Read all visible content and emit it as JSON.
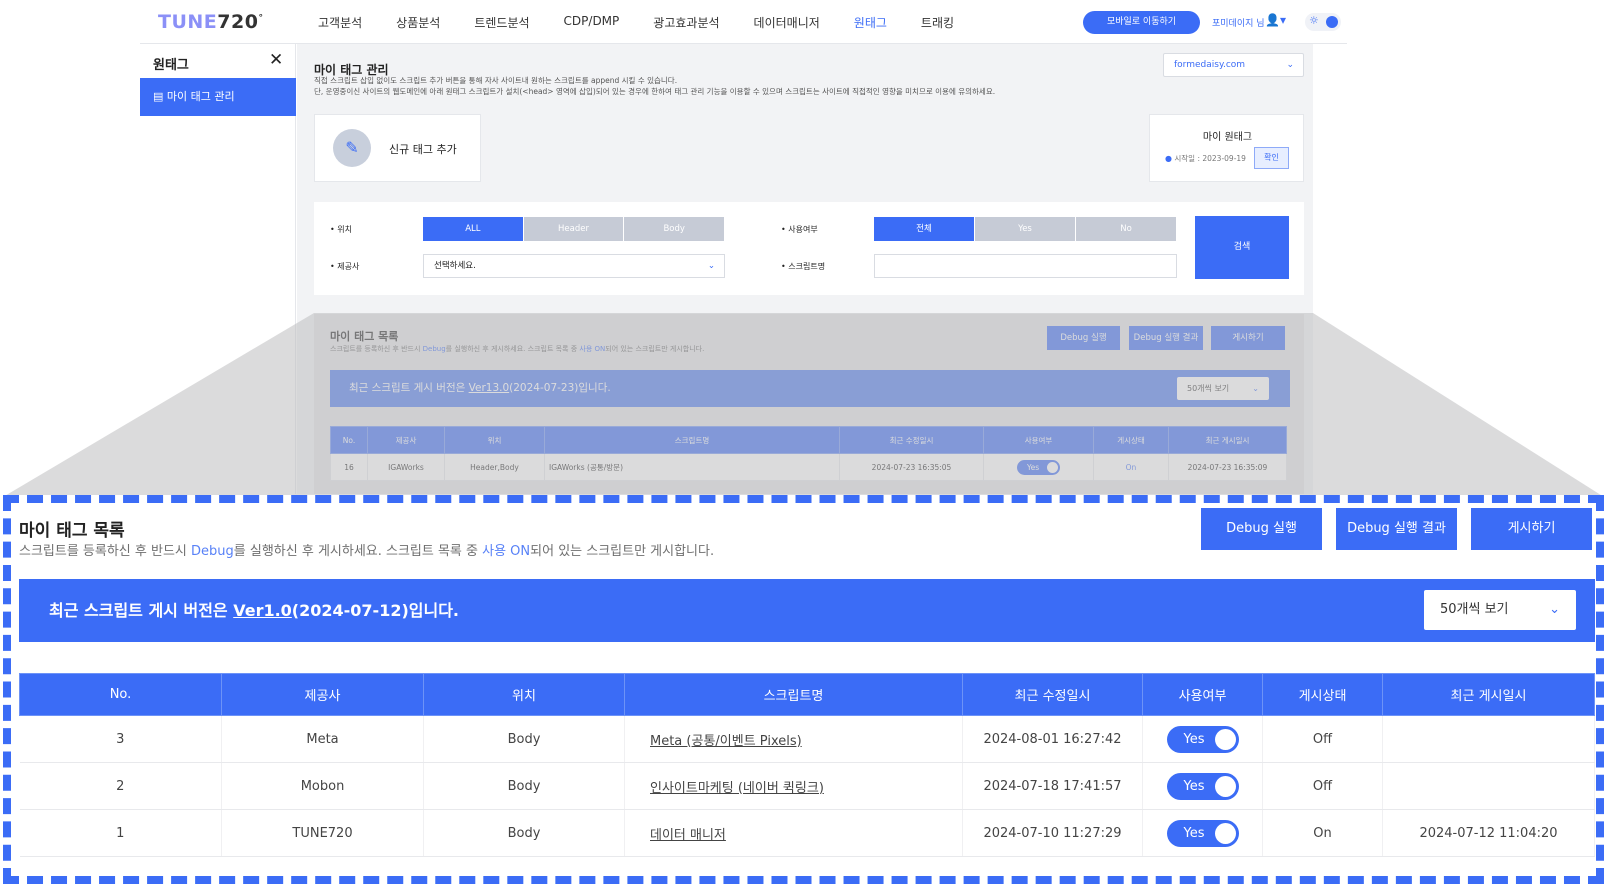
{
  "logo": {
    "part1": "TUNE",
    "part2": "720",
    "mark": "°"
  },
  "nav": {
    "menu": [
      "고객분석",
      "상품분석",
      "트렌드분석",
      "CDP/DMP",
      "광고효과분석",
      "데이터매니저",
      "원태그",
      "트래킹"
    ],
    "active_index": 6,
    "mobile_button": "모바일로 이동하기",
    "fm_link": "포미데이지 님",
    "user_icon": "user-icon",
    "theme_icon": "sun-icon"
  },
  "sidebar": {
    "title": "원태그",
    "close": "✕",
    "items": [
      {
        "label": "마이 태그 관리",
        "icon": "document-icon"
      }
    ]
  },
  "header": {
    "title": "마이 태그 관리",
    "desc1": "직접 스크립트 삽입 없이도 스크립트 추가 버튼을 통해 자사 사이트내 원하는 스크립트를 append 시킬 수 있습니다.",
    "desc2": "단, 운영중이신 사이트의 웹도메인에 아래 원태그 스크립트가 설치(<head> 영역에 삽입)되어 있는 경우에 한하여 태그 관리 기능을 이용할 수 있으며 스크립트는 사이트에 직접적인 영향을 미치므로 이용에 유의하세요.",
    "site_select": "formedaisy.com"
  },
  "new_tag": {
    "label": "신규 태그 추가",
    "icon": "pencil-icon"
  },
  "one_tag": {
    "title": "마이 원태그",
    "start": "시작일 : 2023-09-19",
    "confirm": "확인"
  },
  "filter": {
    "position_label": "• 위치",
    "position_options": [
      "ALL",
      "Header",
      "Body"
    ],
    "position_selected": 0,
    "use_label": "• 사용여부",
    "use_options": [
      "전체",
      "Yes",
      "No"
    ],
    "use_selected": 0,
    "vendor_label": "• 제공사",
    "vendor_select": "선택하세요.",
    "script_label": "• 스크립트명",
    "script_value": "",
    "search": "검색"
  },
  "list_small": {
    "title": "마이 태그 목록",
    "desc_pre": "스크립트를 등록하신 후 반드시 ",
    "desc_debug": "Debug",
    "desc_mid": "를 실행하신 후 게시하세요. 스크립트 목록 중 ",
    "desc_on": "사용 ON",
    "desc_post": "되어 있는 스크립트만 게시합니다.",
    "buttons": [
      "Debug 실행",
      "Debug 실행 결과",
      "게시하기"
    ],
    "banner_pre": "최근 스크립트 게시 버전은 ",
    "banner_ver": "Ver13.0",
    "banner_post": "(2024-07-23)입니다.",
    "page_size": "50개씩 보기",
    "columns": [
      "No.",
      "제공사",
      "위치",
      "스크립트명",
      "최근 수정일시",
      "사용여부",
      "게시상태",
      "최근 게시일시"
    ],
    "row": {
      "no": "16",
      "vendor": "IGAWorks",
      "position": "Header,Body",
      "script": "IGAWorks (공통/방문)",
      "modified": "2024-07-23 16:35:05",
      "use": "Yes",
      "status": "On",
      "published": "2024-07-23 16:35:09"
    }
  },
  "list_zoom": {
    "title": "마이 태그 목록",
    "desc_pre": "스크립트를 등록하신 후 반드시 ",
    "desc_debug": "Debug",
    "desc_mid": "를 실행하신 후 게시하세요. 스크립트 목록 중 ",
    "desc_on": "사용 ON",
    "desc_post": "되어 있는 스크립트만 게시합니다.",
    "buttons": [
      "Debug 실행",
      "Debug 실행 결과",
      "게시하기"
    ],
    "banner_pre": "최근 스크립트 게시 버전은 ",
    "banner_ver": "Ver1.0",
    "banner_post": "(2024-07-12)입니다.",
    "page_size": "50개씩 보기",
    "columns": [
      "No.",
      "제공사",
      "위치",
      "스크립트명",
      "최근 수정일시",
      "사용여부",
      "게시상태",
      "최근 게시일시"
    ],
    "rows": [
      {
        "no": "3",
        "vendor": "Meta",
        "position": "Body",
        "script": "Meta (공통/이벤트 Pixels)",
        "modified": "2024-08-01 16:27:42",
        "use": "Yes",
        "status": "Off",
        "published": ""
      },
      {
        "no": "2",
        "vendor": "Mobon",
        "position": "Body",
        "script": "인사이트마케팅 (네이버 퀵링크)",
        "modified": "2024-07-18 17:41:57",
        "use": "Yes",
        "status": "Off",
        "published": ""
      },
      {
        "no": "1",
        "vendor": "TUNE720",
        "position": "Body",
        "script": "데이터 매니저",
        "modified": "2024-07-10 11:27:29",
        "use": "Yes",
        "status": "On",
        "published": "2024-07-12 11:04:20"
      }
    ]
  },
  "colors": {
    "accent": "#3b6cf6",
    "banner": "#4a79f0",
    "panel": "#f2f3f5"
  }
}
